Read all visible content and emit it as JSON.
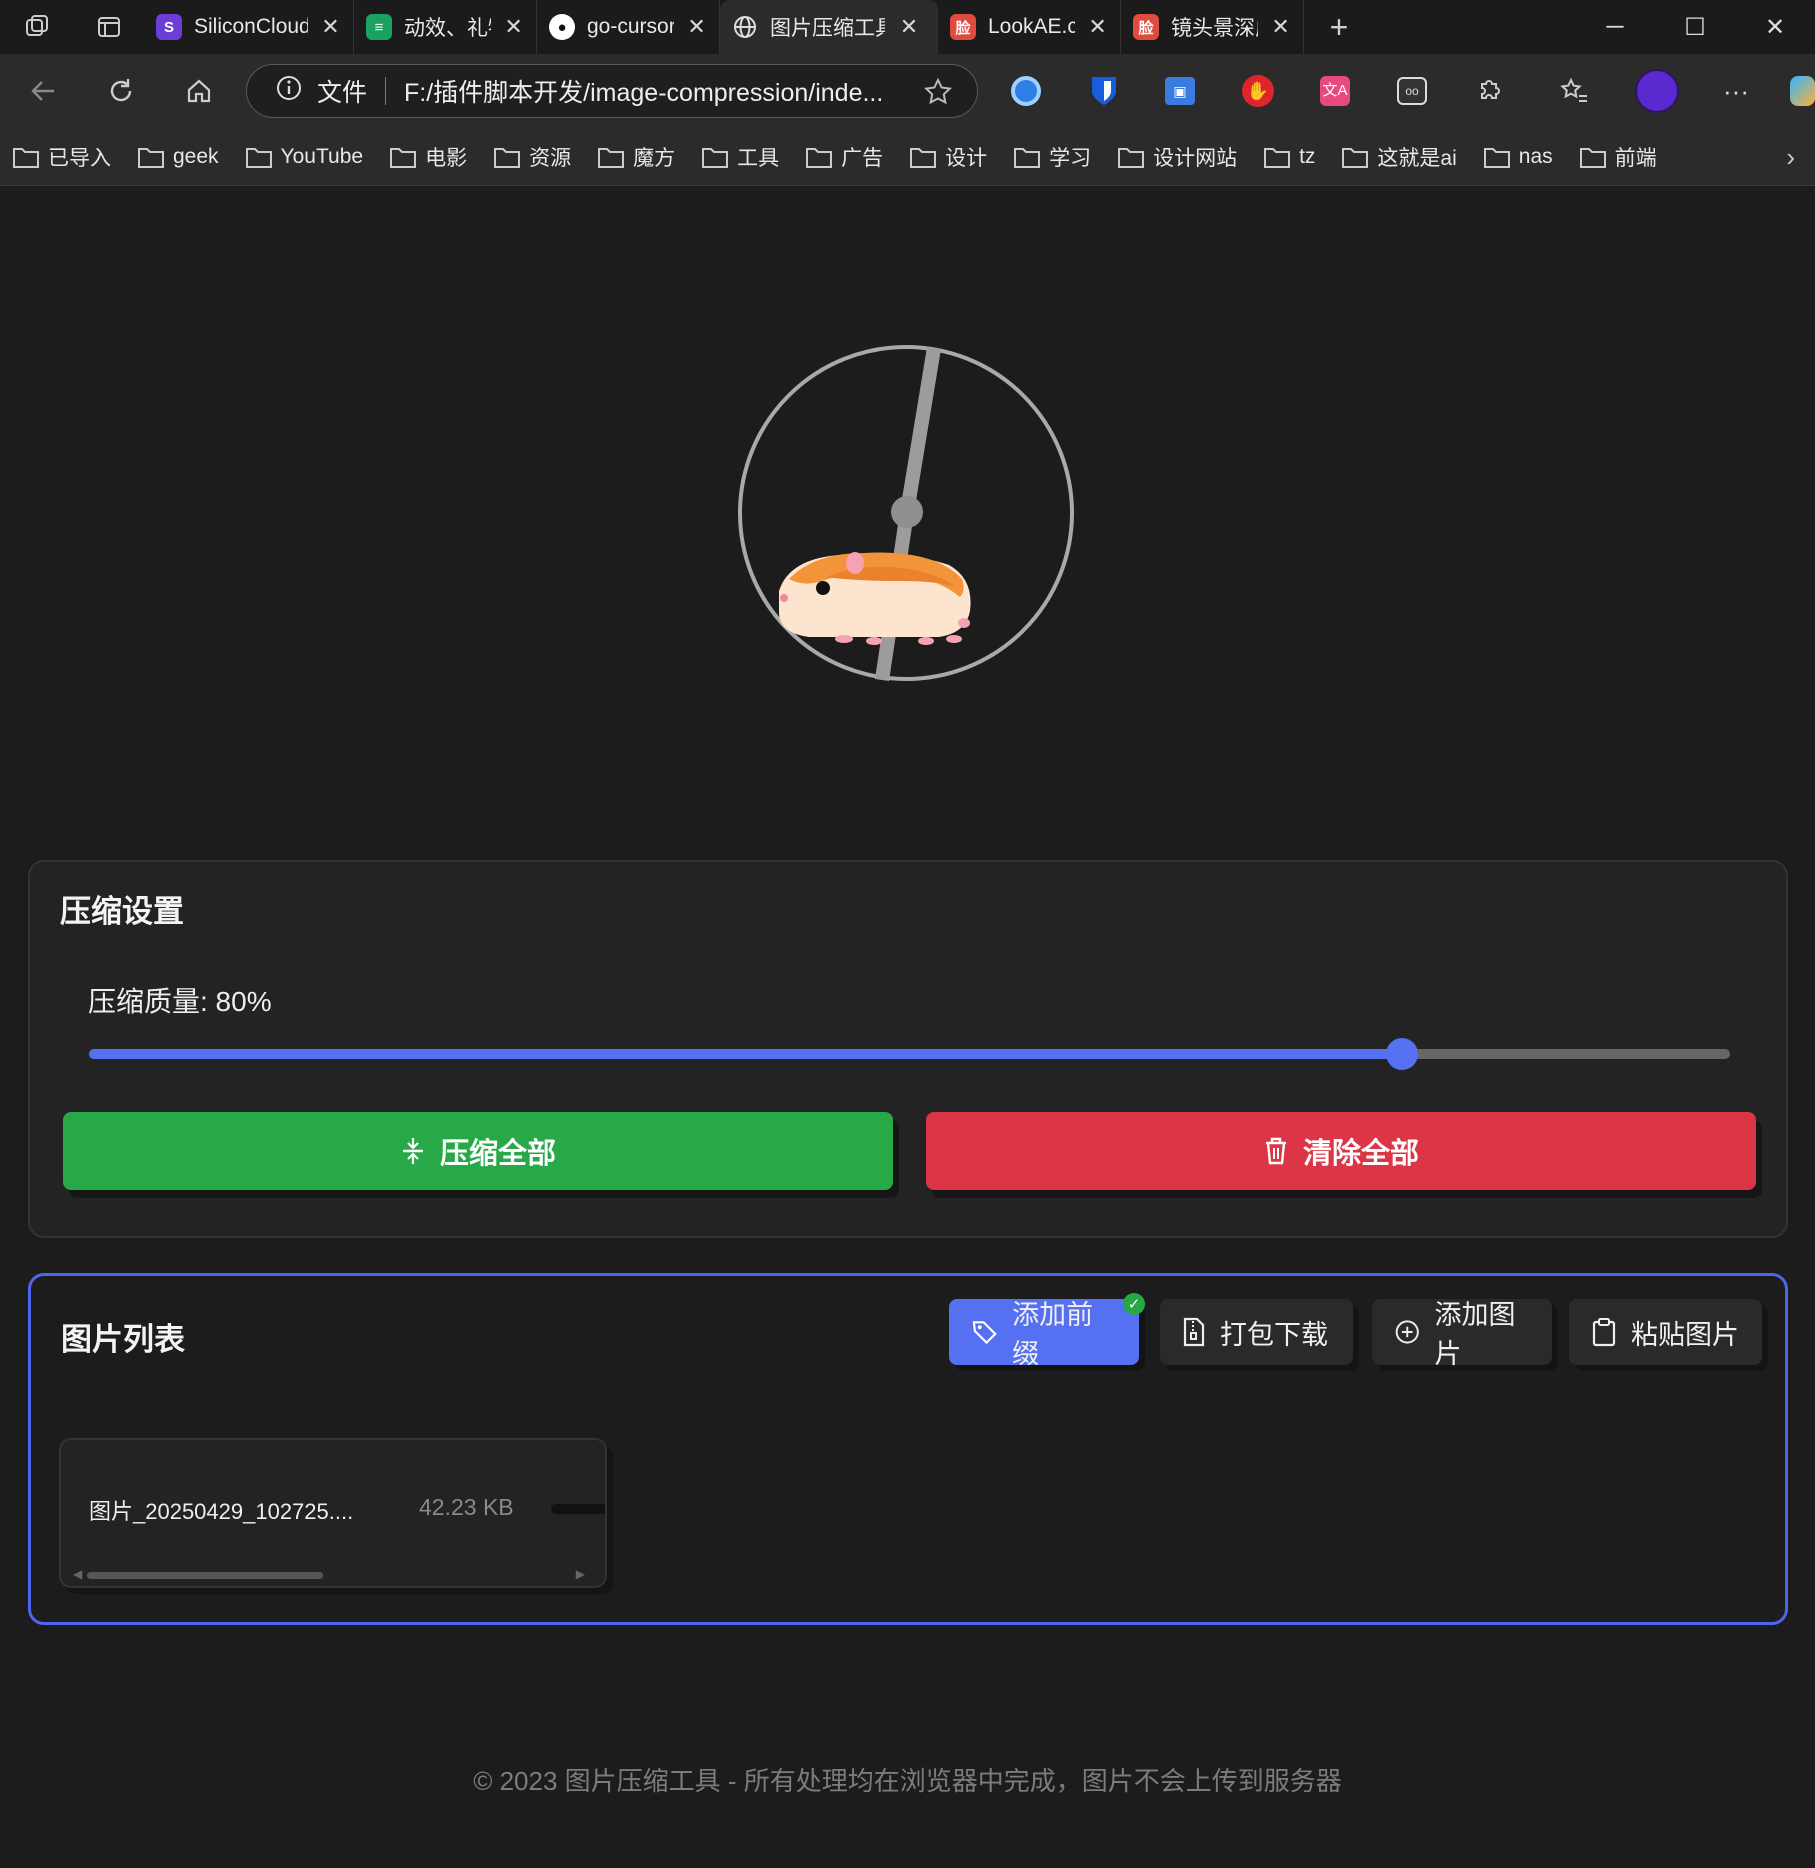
{
  "browser": {
    "tabs": [
      {
        "title": "SiliconCloud",
        "favicon": "siliconcloud-icon",
        "color": "#6b3fd6"
      },
      {
        "title": "动效、礼物、",
        "favicon": "sheets-icon",
        "color": "#1aa260"
      },
      {
        "title": "go-cursor-h",
        "favicon": "github-icon",
        "color": "#ffffff"
      },
      {
        "title": "图片压缩工具",
        "favicon": "globe-icon",
        "color": "#cccccc"
      },
      {
        "title": "LookAE.com",
        "favicon": "lookae-icon",
        "color": "#e04b3f",
        "glyph": "脸"
      },
      {
        "title": "镜头景深虚拟",
        "favicon": "lookae-icon",
        "color": "#e04b3f",
        "glyph": "脸"
      }
    ],
    "address_label": "文件",
    "address_url": "F:/插件脚本开发/image-compression/inde...",
    "bookmarks": [
      "已导入",
      "geek",
      "YouTube",
      "电影",
      "资源",
      "魔方",
      "工具",
      "广告",
      "设计",
      "学习",
      "设计网站",
      "tz",
      "这就是ai",
      "nas",
      "前端"
    ]
  },
  "settings": {
    "title": "压缩设置",
    "quality_label": "压缩质量: 80%",
    "quality_value": 0.8,
    "compress_all": "压缩全部",
    "clear_all": "清除全部"
  },
  "list": {
    "title": "图片列表",
    "add_prefix": "添加前缀",
    "add_prefix_badge": "✓",
    "zip_download": "打包下载",
    "add_image": "添加图片",
    "paste_image": "粘贴图片",
    "files": [
      {
        "name": "图片_20250429_102725....",
        "size": "42.23 KB"
      }
    ]
  },
  "footer": "© 2023 图片压缩工具 - 所有处理均在浏览器中完成，图片不会上传到服务器",
  "colors": {
    "accent": "#5570f0",
    "success": "#27a948",
    "danger": "#dc3545"
  }
}
